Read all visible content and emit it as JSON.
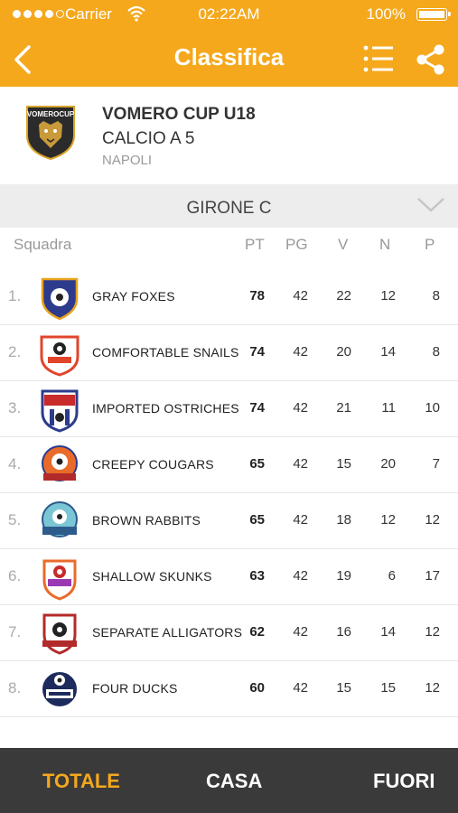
{
  "status_bar": {
    "carrier": "Carrier",
    "time": "02:22AM",
    "battery": "100%",
    "signal_icon": "signal-dots-icon",
    "wifi_icon": "wifi-icon",
    "battery_icon": "battery-icon"
  },
  "navbar": {
    "title": "Classifica",
    "back_icon": "back-chevron-icon",
    "list_icon": "list-icon",
    "share_icon": "share-icon",
    "color": "#F5A81C"
  },
  "league": {
    "logo_text": "VOMEROCUP",
    "name": "VOMERO CUP U18",
    "sport": "CALCIO A 5",
    "city": "NAPOLI"
  },
  "group": {
    "label": "GIRONE C",
    "dropdown_icon": "chevron-down-icon"
  },
  "table": {
    "headers": {
      "team": "Squadra",
      "pt": "PT",
      "pg": "PG",
      "v": "V",
      "n": "N",
      "p": "P"
    },
    "rows": [
      {
        "pos": "1.",
        "team": "GRAY FOXES",
        "pt": "78",
        "pg": "42",
        "v": "22",
        "n": "12",
        "p": "8"
      },
      {
        "pos": "2.",
        "team": "COMFORTABLE SNAILS",
        "pt": "74",
        "pg": "42",
        "v": "20",
        "n": "14",
        "p": "8"
      },
      {
        "pos": "3.",
        "team": "IMPORTED OSTRICHES",
        "pt": "74",
        "pg": "42",
        "v": "21",
        "n": "11",
        "p": "10"
      },
      {
        "pos": "4.",
        "team": "CREEPY COUGARS",
        "pt": "65",
        "pg": "42",
        "v": "15",
        "n": "20",
        "p": "7"
      },
      {
        "pos": "5.",
        "team": "BROWN RABBITS",
        "pt": "65",
        "pg": "42",
        "v": "18",
        "n": "12",
        "p": "12"
      },
      {
        "pos": "6.",
        "team": "SHALLOW SKUNKS",
        "pt": "63",
        "pg": "42",
        "v": "19",
        "n": "6",
        "p": "17"
      },
      {
        "pos": "7.",
        "team": "SEPARATE ALLIGATORS",
        "pt": "62",
        "pg": "42",
        "v": "16",
        "n": "14",
        "p": "12"
      },
      {
        "pos": "8.",
        "team": "FOUR DUCKS",
        "pt": "60",
        "pg": "42",
        "v": "15",
        "n": "15",
        "p": "12"
      }
    ]
  },
  "tabs": {
    "total": "TOTALE",
    "home": "CASA",
    "away": "FUORI"
  }
}
